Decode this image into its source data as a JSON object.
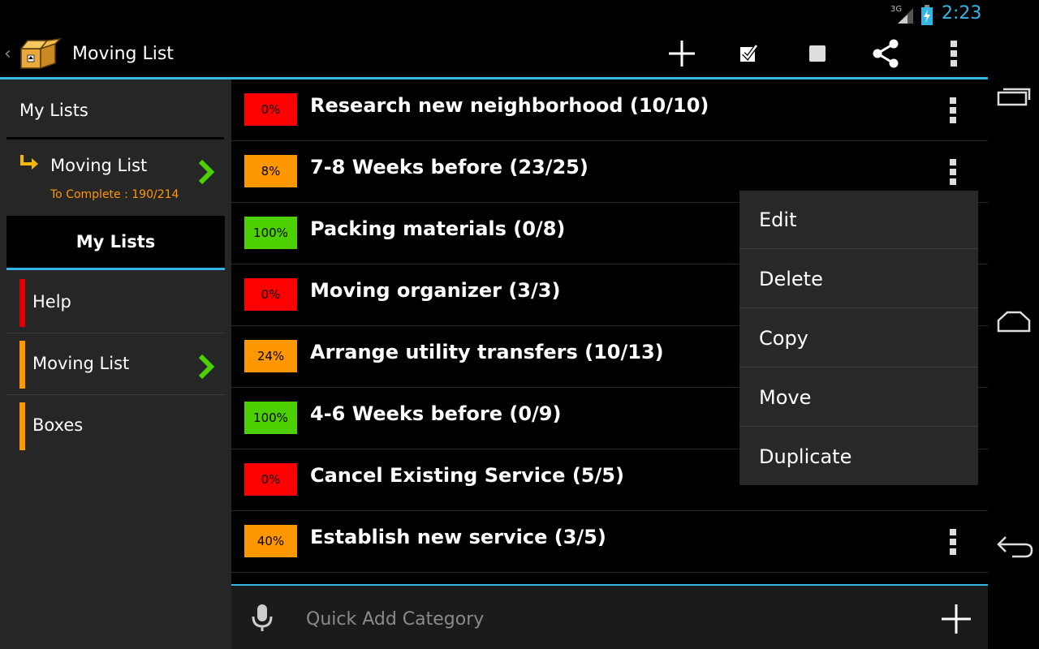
{
  "status_bar": {
    "network": "3G",
    "time": "2:23"
  },
  "action_bar": {
    "title": "Moving List",
    "actions": [
      "add-icon",
      "check-all-icon",
      "uncheck-all-icon",
      "share-icon",
      "overflow-icon"
    ]
  },
  "sidebar": {
    "header": "My Lists",
    "current": {
      "title": "Moving List",
      "subtitle": "To Complete : 190/214"
    },
    "section_title": "My Lists",
    "items": [
      {
        "label": "Help",
        "color": "#e00000"
      },
      {
        "label": "Moving List",
        "color": "#ff9800"
      },
      {
        "label": "Boxes",
        "color": "#ff9800"
      }
    ]
  },
  "categories": [
    {
      "percent": "0%",
      "title": "Research new neighborhood (10/10)",
      "color": "#ff0000"
    },
    {
      "percent": "8%",
      "title": "7-8 Weeks before (23/25)",
      "color": "#ff9800"
    },
    {
      "percent": "100%",
      "title": "Packing materials (0/8)",
      "color": "#4cd000"
    },
    {
      "percent": "0%",
      "title": "Moving organizer (3/3)",
      "color": "#ff0000"
    },
    {
      "percent": "24%",
      "title": "Arrange utility transfers (10/13)",
      "color": "#ff9800"
    },
    {
      "percent": "100%",
      "title": "4-6 Weeks before (0/9)",
      "color": "#4cd000"
    },
    {
      "percent": "0%",
      "title": "Cancel Existing Service (5/5)",
      "color": "#ff0000"
    },
    {
      "percent": "40%",
      "title": "Establish new service (3/5)",
      "color": "#ff9800"
    }
  ],
  "context_menu": {
    "items": [
      "Edit",
      "Delete",
      "Copy",
      "Move",
      "Duplicate"
    ]
  },
  "quick_add": {
    "placeholder": "Quick Add Category"
  },
  "colors": {
    "accent": "#33b5e5"
  }
}
